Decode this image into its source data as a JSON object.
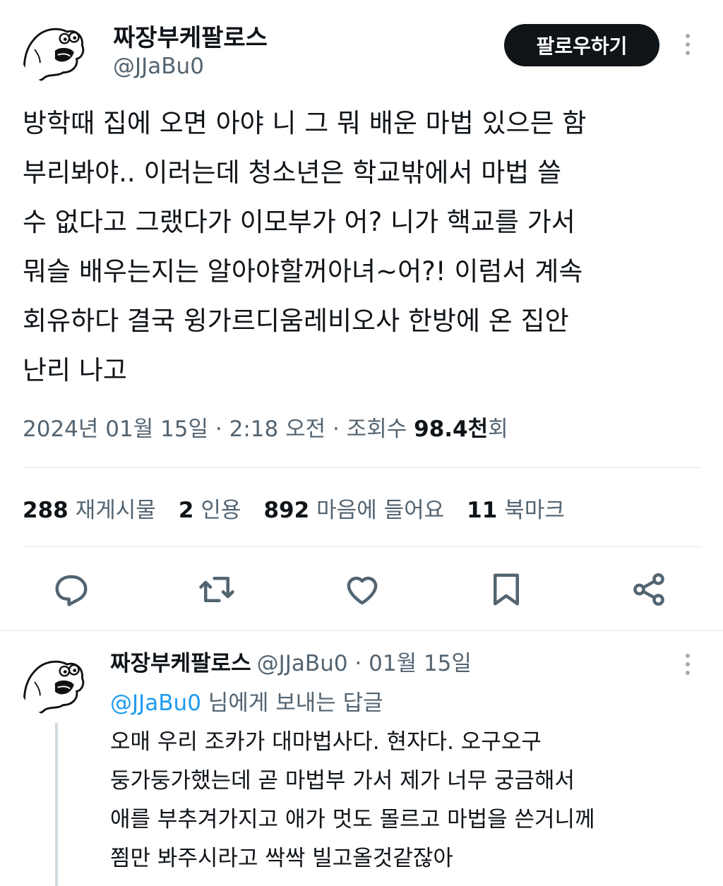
{
  "main_tweet": {
    "author": {
      "display_name": "짜장부케팔로스",
      "handle": "@JJaBu0",
      "avatar_icon": "cartoon-creature-avatar-icon"
    },
    "follow_label": "팔로우하기",
    "text": "방학때 집에 오면 아야 니 그 뭐 배운 마법 있으믄 함\n부리봐야.. 이러는데 청소년은 학교밖에서 마법 쓸\n수 없다고 그랬다가 이모부가 어? 니가 핵교를 가서\n뭐슬 배우는지는 알아야할꺼아녀~어?! 이럼서 계속\n회유하다 결국 윙가르디움레비오사 한방에 온 집안\n난리 나고",
    "meta": {
      "date": "2024년 01월 15일",
      "separator": " · ",
      "time": "2:18 오전",
      "views_label": "조회수 ",
      "views_count": "98.4천",
      "views_suffix": "회"
    },
    "stats": [
      {
        "count": "288",
        "label": "재게시물"
      },
      {
        "count": "2",
        "label": "인용"
      },
      {
        "count": "892",
        "label": "마음에 들어요"
      },
      {
        "count": "11",
        "label": "북마크"
      }
    ],
    "actions": [
      "reply-icon",
      "retweet-icon",
      "heart-icon",
      "bookmark-icon",
      "share-icon"
    ]
  },
  "reply_tweet": {
    "author": {
      "display_name": "짜장부케팔로스",
      "handle": "@JJaBu0",
      "avatar_icon": "cartoon-creature-avatar-icon"
    },
    "header_suffix": " · 01월 15일",
    "replying_to": {
      "mention": "@JJaBu0",
      "suffix": " 님에게 보내는 답글"
    },
    "text": "오매 우리 조카가 대마법사다. 현자다. 오구오구\n둥가둥가했는데 곧 마법부 가서 제가 너무 궁금해서\n애를 부추겨가지고 애가 멋도 몰르고 마법을 쓴거니께\n쬠만 봐주시라고 싹싹 빌고올것같잖아"
  },
  "colors": {
    "text_primary": "#0f1419",
    "text_secondary": "#536471",
    "link": "#1d9bf0",
    "divider": "#e1e8ed",
    "follow_bg": "#0f1419"
  }
}
